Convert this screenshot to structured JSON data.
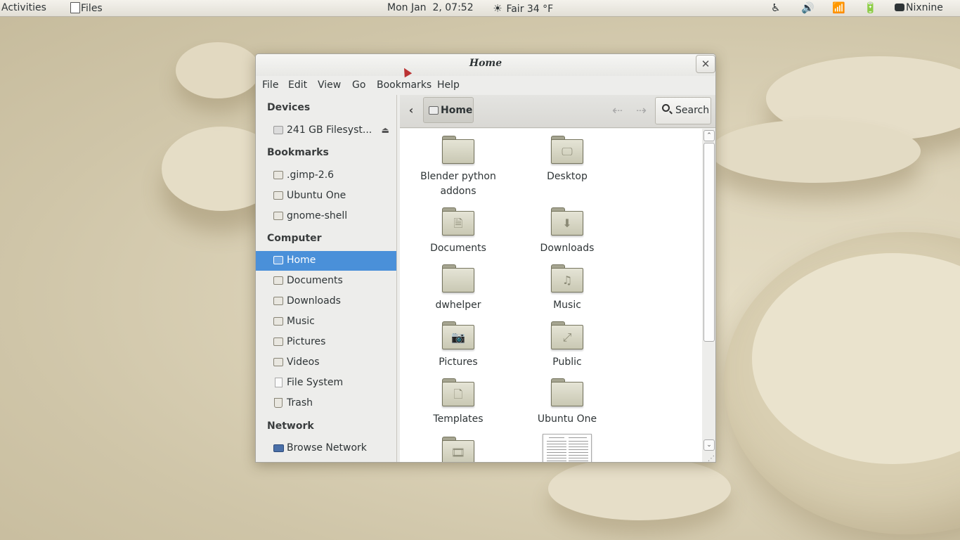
{
  "topbar": {
    "activities": "Activities",
    "app_name": "Files",
    "clock": "Mon Jan  2, 07:52",
    "weather": "Fair 34 °F",
    "indicators": [
      "accessibility-icon",
      "volume-icon",
      "wifi-icon",
      "battery-icon"
    ],
    "user": "Nixnine"
  },
  "window": {
    "title": "Home",
    "close_symbol": "✕",
    "menu": [
      "File",
      "Edit",
      "View",
      "Go",
      "Bookmarks",
      "Help"
    ]
  },
  "sidebar": {
    "devices_heading": "Devices",
    "devices": [
      {
        "label": "241 GB Filesyst...",
        "icon": "hdd-icon"
      }
    ],
    "bookmarks_heading": "Bookmarks",
    "bookmarks": [
      {
        "label": ".gimp-2.6",
        "icon": "folder-icon"
      },
      {
        "label": "Ubuntu One",
        "icon": "folder-icon"
      },
      {
        "label": "gnome-shell",
        "icon": "folder-icon"
      }
    ],
    "computer_heading": "Computer",
    "computer": [
      {
        "label": "Home",
        "icon": "home-folder-icon",
        "selected": true
      },
      {
        "label": "Documents",
        "icon": "documents-folder-icon"
      },
      {
        "label": "Downloads",
        "icon": "downloads-folder-icon"
      },
      {
        "label": "Music",
        "icon": "music-folder-icon"
      },
      {
        "label": "Pictures",
        "icon": "pictures-folder-icon"
      },
      {
        "label": "Videos",
        "icon": "videos-folder-icon"
      },
      {
        "label": "File System",
        "icon": "file-system-icon"
      },
      {
        "label": "Trash",
        "icon": "trash-icon"
      }
    ],
    "network_heading": "Network",
    "network": [
      {
        "label": "Browse Network",
        "icon": "network-icon"
      }
    ]
  },
  "toolbar": {
    "breadcrumb": "Home",
    "search_label": "Search"
  },
  "files": [
    {
      "name": "Blender python addons",
      "emblem": ""
    },
    {
      "name": "Desktop",
      "emblem": "🖵"
    },
    {
      "name": "Documents",
      "emblem": "🗎"
    },
    {
      "name": "Downloads",
      "emblem": "⬇"
    },
    {
      "name": "dwhelper",
      "emblem": ""
    },
    {
      "name": "Music",
      "emblem": "♫"
    },
    {
      "name": "Pictures",
      "emblem": "📷"
    },
    {
      "name": "Public",
      "emblem": "⤢"
    },
    {
      "name": "Templates",
      "emblem": "🗋"
    },
    {
      "name": "Ubuntu One",
      "emblem": ""
    },
    {
      "name": "",
      "emblem": "🎞"
    },
    {
      "name": "",
      "emblem": "document-thumbnail"
    }
  ],
  "colors": {
    "selection": "#4a90d9",
    "folder": "#d6d5c3"
  }
}
